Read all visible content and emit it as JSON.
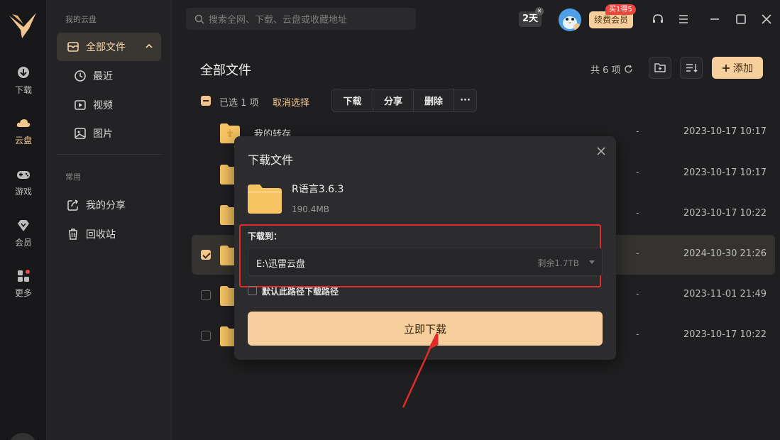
{
  "rail": {
    "items": [
      {
        "label": "下载",
        "icon": "download-icon"
      },
      {
        "label": "云盘",
        "icon": "cloud-icon"
      },
      {
        "label": "游戏",
        "icon": "gamepad-icon"
      },
      {
        "label": "会员",
        "icon": "diamond-icon"
      },
      {
        "label": "更多",
        "icon": "grid-icon"
      }
    ],
    "active": "云盘",
    "accent": "#f2c58f"
  },
  "sidenav": {
    "section1": "我的云盘",
    "items1": [
      {
        "label": "全部文件",
        "icon": "folder-icon"
      },
      {
        "label": "最近",
        "icon": "clock-icon"
      },
      {
        "label": "视频",
        "icon": "video-icon"
      },
      {
        "label": "图片",
        "icon": "image-icon"
      }
    ],
    "section2": "常用",
    "items2": [
      {
        "label": "我的分享",
        "icon": "share-icon"
      },
      {
        "label": "回收站",
        "icon": "trash-icon"
      }
    ]
  },
  "topbar": {
    "search_placeholder": "搜索全网、下载、云盘或收藏地址",
    "days_badge": "2天",
    "vip_button": "续费会员",
    "vip_tag": "买1得5"
  },
  "content": {
    "title": "全部文件",
    "count": "共 6 项",
    "add_button": "添加",
    "selection": {
      "selected_text": "已选 1 项",
      "cancel": "取消选择",
      "actions": [
        "下载",
        "分享",
        "删除",
        "···"
      ]
    },
    "files": [
      {
        "name": "我的转存",
        "size": "-",
        "date": "2023-10-17 10:17",
        "checked": false
      },
      {
        "name": "",
        "size": "-",
        "date": "2023-10-17 10:17",
        "checked": false
      },
      {
        "name": "",
        "size": "-",
        "date": "2023-10-17 10:22",
        "checked": false
      },
      {
        "name": "",
        "size": "-",
        "date": "2024-10-30 21:26",
        "checked": true
      },
      {
        "name": "",
        "size": "-",
        "date": "2023-11-01 21:49",
        "checked": false
      },
      {
        "name": "",
        "size": "-",
        "date": "2023-10-17 10:22",
        "checked": false
      }
    ]
  },
  "dialog": {
    "title": "下载文件",
    "file_name": "R语言3.6.3",
    "file_size": "190.4MB",
    "download_to_label": "下载到：",
    "path": "E:\\迅雷云盘",
    "free_space": "剩余1.7TB",
    "default_path_label": "默认此路径下载路径",
    "download_button": "立即下载"
  },
  "annotation_color": "#e02b2b"
}
